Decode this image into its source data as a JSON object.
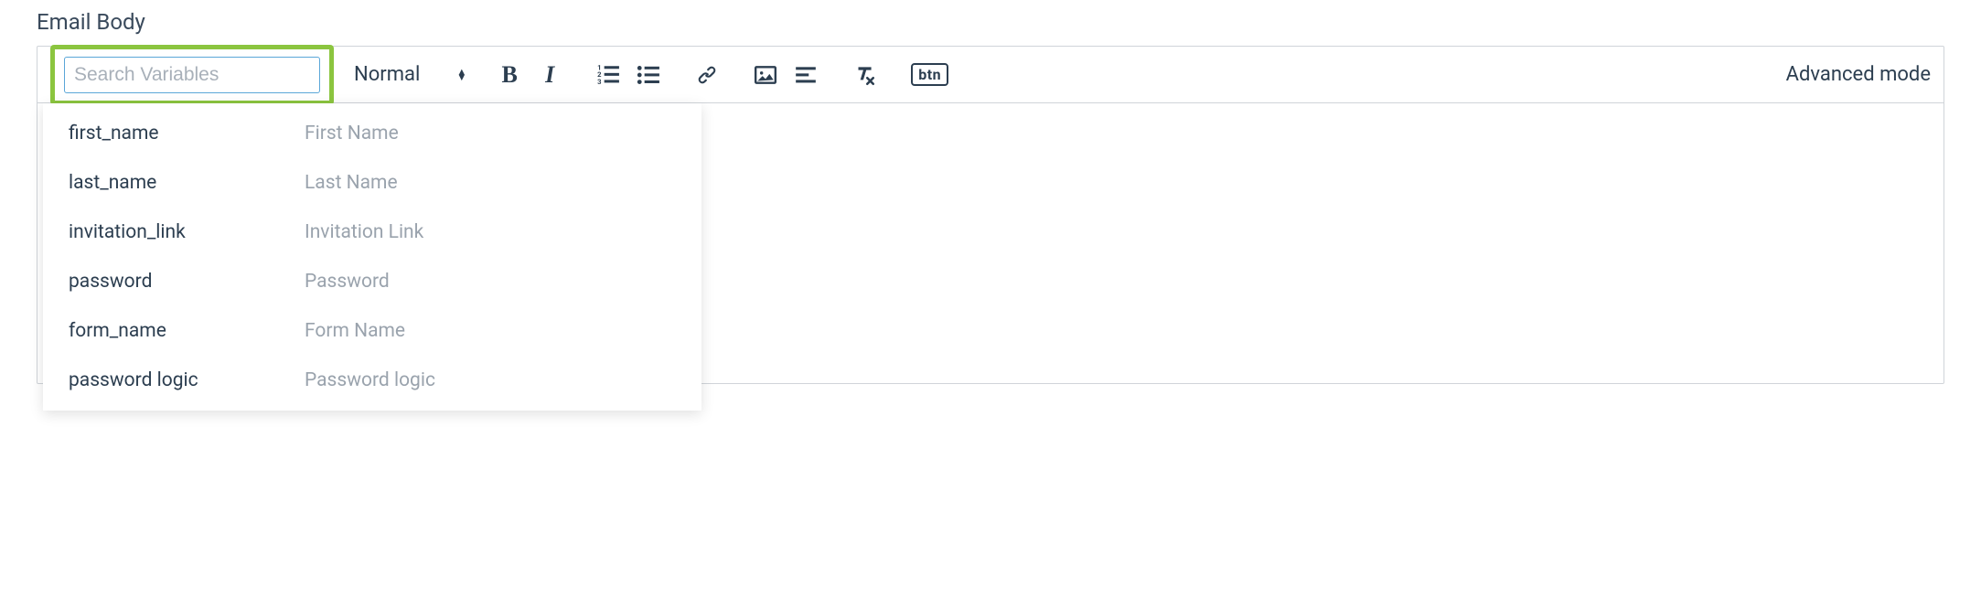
{
  "section": {
    "title": "Email Body"
  },
  "toolbar": {
    "search_placeholder": "Search Variables",
    "format_label": "Normal",
    "advanced_label": "Advanced mode",
    "btn_label": "btn"
  },
  "variables": [
    {
      "key": "first_name",
      "label": "First Name"
    },
    {
      "key": "last_name",
      "label": "Last Name"
    },
    {
      "key": "invitation_link",
      "label": "Invitation Link"
    },
    {
      "key": "password",
      "label": "Password"
    },
    {
      "key": "form_name",
      "label": "Form Name"
    },
    {
      "key": "password logic",
      "label": "Password logic"
    }
  ]
}
